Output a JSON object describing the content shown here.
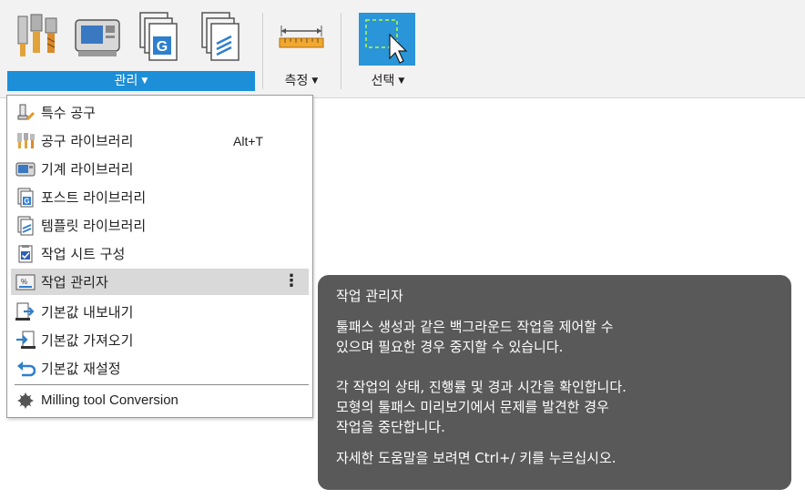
{
  "ribbon": {
    "groups": [
      {
        "label": "관리",
        "active": true
      },
      {
        "label": "측정",
        "active": false
      },
      {
        "label": "선택",
        "active": false
      }
    ],
    "manage_icons": [
      "tool-library-icon",
      "machine-library-icon",
      "post-library-icon",
      "template-library-icon"
    ],
    "accent_color": "#1c8fd8"
  },
  "menu": {
    "items": [
      {
        "label": "특수 공구",
        "icon": "special-tool-icon",
        "shortcut": ""
      },
      {
        "label": "공구 라이브러리",
        "icon": "tool-library-icon",
        "shortcut": "Alt+T"
      },
      {
        "label": "기계 라이브러리",
        "icon": "machine-library-icon",
        "shortcut": ""
      },
      {
        "label": "포스트 라이브러리",
        "icon": "post-library-icon",
        "shortcut": ""
      },
      {
        "label": "템플릿 라이브러리",
        "icon": "template-library-icon",
        "shortcut": ""
      },
      {
        "label": "작업 시트 구성",
        "icon": "setup-sheet-icon",
        "shortcut": ""
      },
      {
        "label": "작업 관리자",
        "icon": "task-manager-icon",
        "shortcut": "",
        "highlighted": true
      },
      {
        "label": "기본값 내보내기",
        "icon": "export-defaults-icon",
        "shortcut": ""
      },
      {
        "label": "기본값 가져오기",
        "icon": "import-defaults-icon",
        "shortcut": ""
      },
      {
        "label": "기본값 재설정",
        "icon": "reset-defaults-icon",
        "shortcut": ""
      },
      {
        "label": "Milling tool Conversion",
        "icon": "milling-conversion-icon",
        "shortcut": ""
      }
    ],
    "more_glyph": "⋮"
  },
  "tooltip": {
    "title": "작업 관리자",
    "paragraph1": [
      "툴패스 생성과 같은 백그라운드 작업을 제어할 수",
      "있으며 필요한 경우 중지할 수 있습니다."
    ],
    "paragraph2": [
      "각 작업의 상태, 진행률 및 경과 시간을 확인합니다.",
      "모형의 툴패스 미리보기에서 문제를 발견한 경우",
      "작업을 중단합니다."
    ],
    "help": "자세한 도움말을 보려면 Ctrl+/ 키를 누르십시오."
  }
}
